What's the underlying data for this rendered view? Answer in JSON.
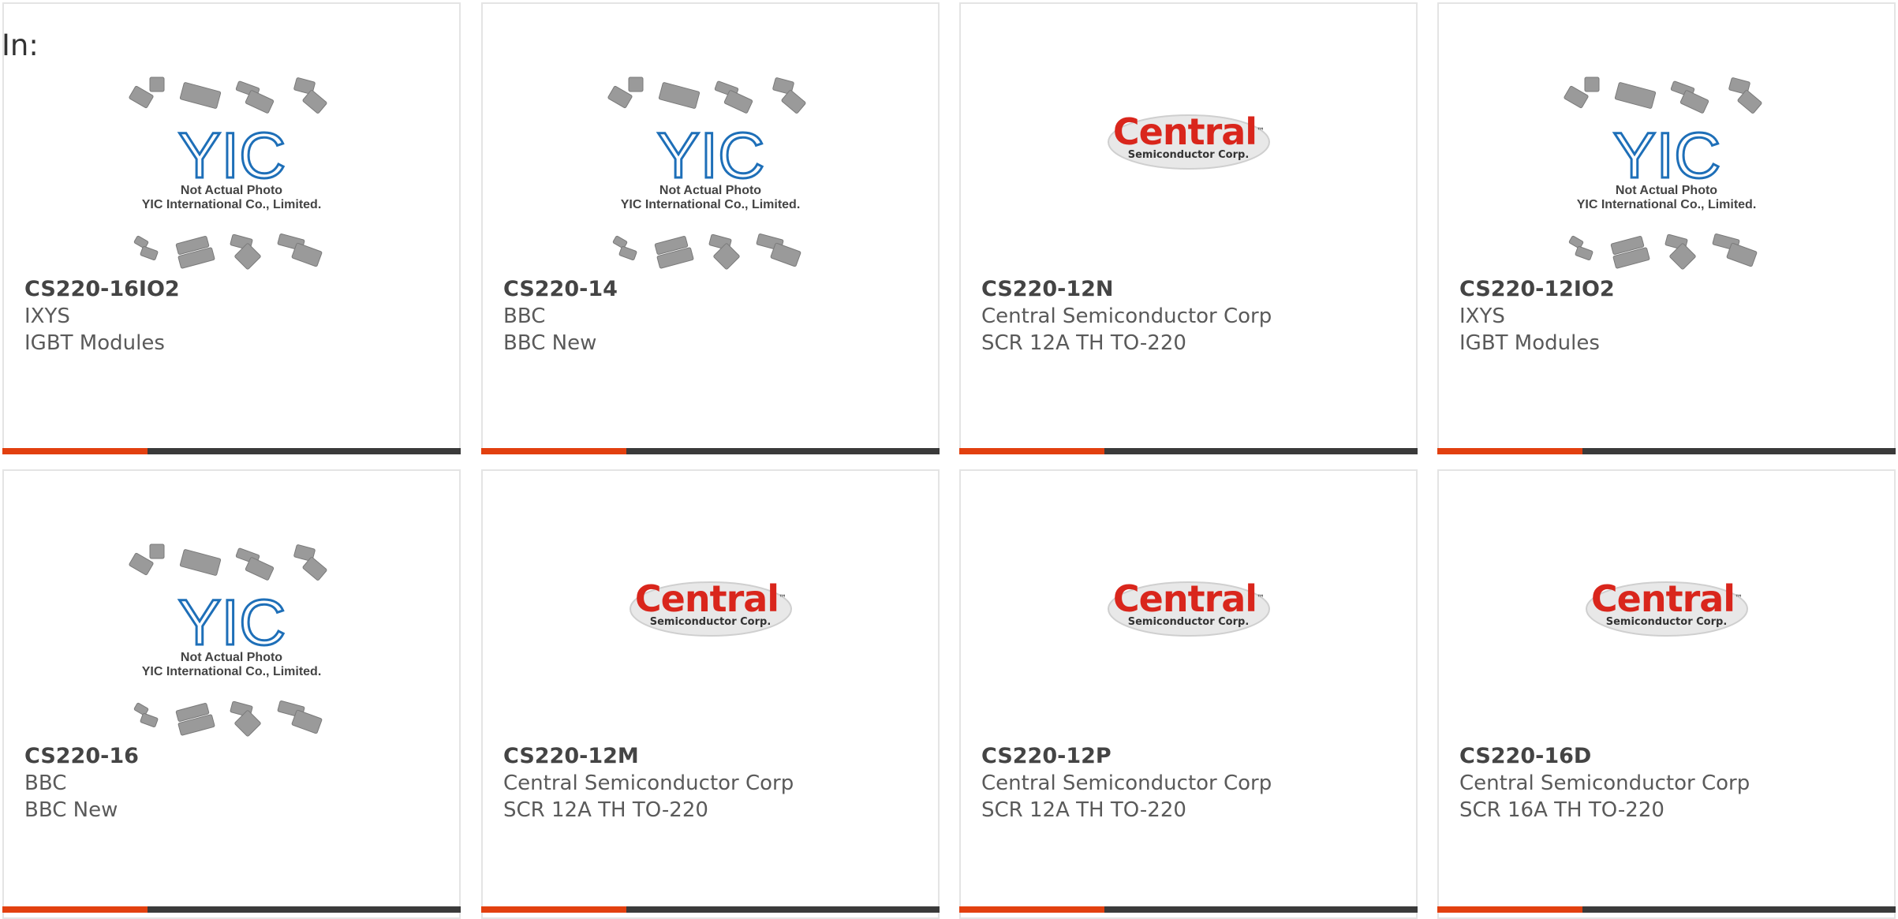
{
  "header": {
    "in_label": "In:"
  },
  "placeholder": {
    "line1": "Not Actual Photo",
    "line2": "YIC International Co., Limited.",
    "logo_text": "YIC"
  },
  "central_logo": {
    "word": "Central",
    "sub": "Semiconductor Corp.",
    "tm": "™"
  },
  "colors": {
    "accent": "#e2400f",
    "bar": "#3a3a3a",
    "central_red": "#d9261c",
    "yic_blue": "#1e6fb8"
  },
  "products": [
    {
      "part": "CS220-16IO2",
      "manufacturer": "IXYS",
      "description": "IGBT Modules",
      "image": "yic-placeholder"
    },
    {
      "part": "CS220-14",
      "manufacturer": "BBC",
      "description": "BBC New",
      "image": "yic-placeholder"
    },
    {
      "part": "CS220-12N",
      "manufacturer": "Central Semiconductor Corp",
      "description": "SCR 12A TH TO-220",
      "image": "central-logo"
    },
    {
      "part": "CS220-12IO2",
      "manufacturer": "IXYS",
      "description": "IGBT Modules",
      "image": "yic-placeholder"
    },
    {
      "part": "CS220-16",
      "manufacturer": "BBC",
      "description": "BBC New",
      "image": "yic-placeholder"
    },
    {
      "part": "CS220-12M",
      "manufacturer": "Central Semiconductor Corp",
      "description": "SCR 12A TH TO-220",
      "image": "central-logo"
    },
    {
      "part": "CS220-12P",
      "manufacturer": "Central Semiconductor Corp",
      "description": "SCR 12A TH TO-220",
      "image": "central-logo"
    },
    {
      "part": "CS220-16D",
      "manufacturer": "Central Semiconductor Corp",
      "description": "SCR 16A TH TO-220",
      "image": "central-logo"
    }
  ]
}
